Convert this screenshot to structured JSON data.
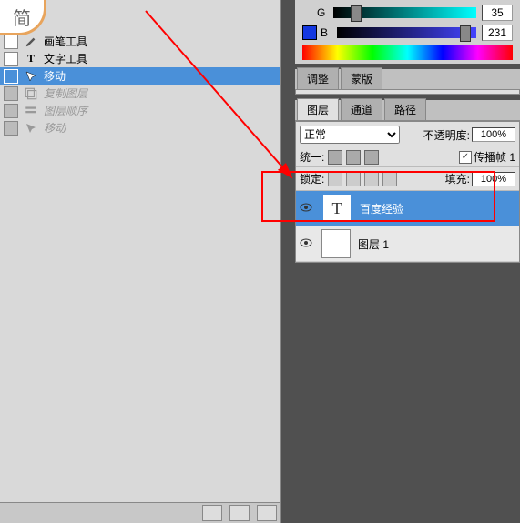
{
  "tools": {
    "brush": "画笔工具",
    "text": "文字工具",
    "move": "移动",
    "copy_layer": "复制图层",
    "layer_order": "图层顺序",
    "move2": "移动"
  },
  "color": {
    "g_label": "G",
    "g_value": "35",
    "b_label": "B",
    "b_value": "231"
  },
  "tabs_upper": [
    "调整",
    "蒙版"
  ],
  "tabs_lower": [
    "图层",
    "通道",
    "路径"
  ],
  "layers": {
    "blend_mode": "正常",
    "opacity_label": "不透明度:",
    "opacity_value": "100%",
    "unify_label": "统一:",
    "propagate_label": "传播帧 1",
    "lock_label": "锁定:",
    "fill_label": "填充:",
    "fill_value": "100%",
    "items": [
      {
        "name": "百度经验",
        "type": "T",
        "selected": true
      },
      {
        "name": "图层 1",
        "type": "blank",
        "selected": false
      }
    ]
  },
  "sticker_text": "简"
}
